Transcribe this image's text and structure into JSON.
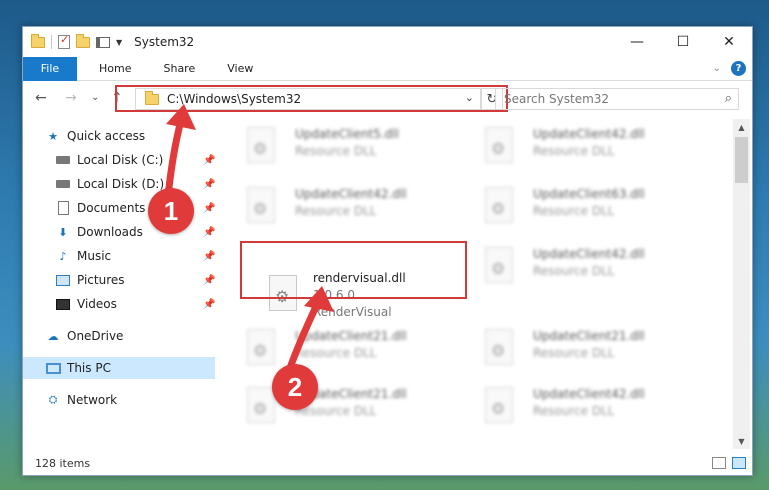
{
  "window": {
    "title": "System32",
    "controls": {
      "minimize": "—",
      "maximize": "☐",
      "close": "✕"
    }
  },
  "ribbon": {
    "tabs": [
      "File",
      "Home",
      "Share",
      "View"
    ]
  },
  "nav": {
    "back": "←",
    "forward": "→",
    "recent": "⌄",
    "up": "↑",
    "address": "C:\\Windows\\System32",
    "address_dropdown": "⌄",
    "refresh": "↻",
    "search_placeholder": "Search System32",
    "search_icon": "⌕"
  },
  "sidebar": {
    "items": [
      {
        "label": "Quick access",
        "icon": "star-icon",
        "pinned": false
      },
      {
        "label": "Local Disk (C:)",
        "icon": "drive-icon",
        "pinned": true
      },
      {
        "label": "Local Disk (D:)",
        "icon": "drive-icon",
        "pinned": true
      },
      {
        "label": "Documents",
        "icon": "documents-icon",
        "pinned": true
      },
      {
        "label": "Downloads",
        "icon": "downloads-icon",
        "pinned": true
      },
      {
        "label": "Music",
        "icon": "music-icon",
        "pinned": true
      },
      {
        "label": "Pictures",
        "icon": "pictures-icon",
        "pinned": true
      },
      {
        "label": "Videos",
        "icon": "videos-icon",
        "pinned": true
      },
      {
        "label": "OneDrive",
        "icon": "onedrive-icon",
        "pinned": false
      },
      {
        "label": "This PC",
        "icon": "this-pc-icon",
        "pinned": false,
        "selected": true
      },
      {
        "label": "Network",
        "icon": "network-icon",
        "pinned": false
      }
    ]
  },
  "files": [
    {
      "name": "UpdateClient5.dll",
      "sub1": "Resource DLL",
      "sub2": ""
    },
    {
      "name": "UpdateClient42.dll",
      "sub1": "Resource DLL",
      "sub2": ""
    },
    {
      "name": "UpdateClient42.dll",
      "sub1": "Resource DLL",
      "sub2": ""
    },
    {
      "name": "UpdateClient63.dll",
      "sub1": "Resource DLL",
      "sub2": ""
    },
    {
      "name": "rendervisual.dll",
      "sub1": "1.0.6.0",
      "sub2": "RenderVisual",
      "highlighted": true
    },
    {
      "name": "UpdateClient42.dll",
      "sub1": "Resource DLL",
      "sub2": ""
    },
    {
      "name": "UpdateClient21.dll",
      "sub1": "Resource DLL",
      "sub2": ""
    },
    {
      "name": "UpdateClient21.dll",
      "sub1": "Resource DLL",
      "sub2": ""
    },
    {
      "name": "UpdateClient21.dll",
      "sub1": "Resource DLL",
      "sub2": ""
    },
    {
      "name": "UpdateClient42.dll",
      "sub1": "Resource DLL",
      "sub2": ""
    }
  ],
  "status": {
    "item_count": "128 items"
  },
  "annotations": {
    "step1": "1",
    "step2": "2"
  },
  "colors": {
    "accent": "#1979ca",
    "highlight": "#d23a3a",
    "selected": "#cce8ff"
  }
}
